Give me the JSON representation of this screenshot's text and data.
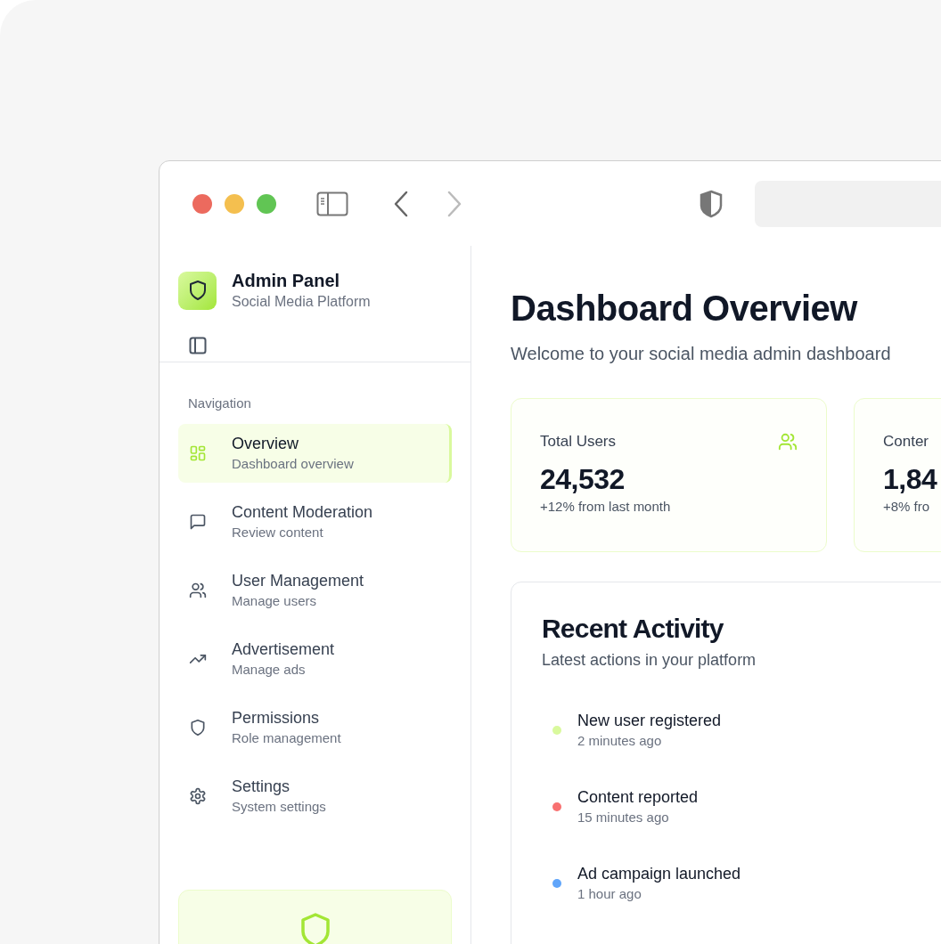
{
  "sidebar": {
    "brand": {
      "title": "Admin Panel",
      "subtitle": "Social Media Platform"
    },
    "section_label": "Navigation",
    "items": [
      {
        "label": "Overview",
        "description": "Dashboard overview",
        "selected": true
      },
      {
        "label": "Content Moderation",
        "description": "Review content",
        "selected": false
      },
      {
        "label": "User Management",
        "description": "Manage users",
        "selected": false
      },
      {
        "label": "Advertisement",
        "description": "Manage ads",
        "selected": false
      },
      {
        "label": "Permissions",
        "description": "Role management",
        "selected": false
      },
      {
        "label": "Settings",
        "description": "System settings",
        "selected": false
      }
    ]
  },
  "main": {
    "title": "Dashboard Overview",
    "subtitle": "Welcome to your social media admin dashboard",
    "stats": [
      {
        "label": "Total Users",
        "value": "24,532",
        "change": "+12% from last month"
      },
      {
        "label": "Conter",
        "value": "1,84",
        "change": "+8% fro"
      }
    ],
    "activity": {
      "title": "Recent Activity",
      "subtitle": "Latest actions in your platform",
      "items": [
        {
          "text": "New user registered",
          "time": "2 minutes ago",
          "color": "#d9f99d"
        },
        {
          "text": "Content reported",
          "time": "15 minutes ago",
          "color": "#f87171"
        },
        {
          "text": "Ad campaign launched",
          "time": "1 hour ago",
          "color": "#60a5fa"
        }
      ]
    }
  }
}
